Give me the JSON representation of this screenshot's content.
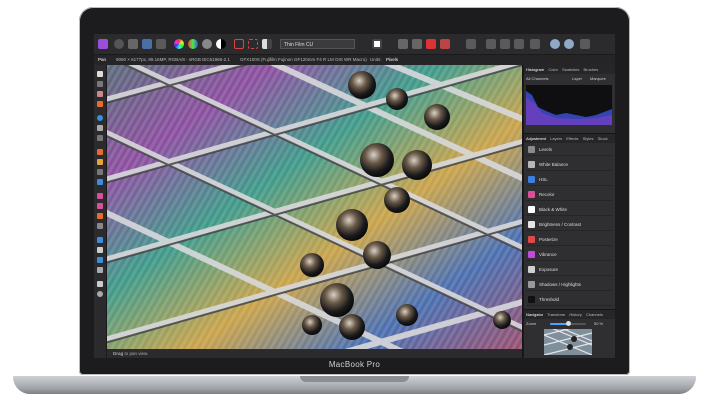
{
  "device": {
    "brand_label": "MacBook Pro"
  },
  "toolbar": {
    "persona_label": "Affinity Photo",
    "document_name": "Thin Film CU"
  },
  "context_bar": {
    "tool_name": "Pan",
    "doc_info": "9060 × 6177px, 89.16MP, RGBA/8 - sRGB IEC61966-2.1",
    "camera_info": "GFX100S (Fujifilm Fujinon GF120mm F4 R LM OIS WR Macro)",
    "units_label": "Units:",
    "units_value": "Pixels"
  },
  "histogram_panel": {
    "tabs": [
      "Histogram",
      "Color",
      "Swatches",
      "Brushes"
    ],
    "channel": "All Channels",
    "layer_label": "Layer",
    "marquee_label": "Marquee"
  },
  "adjustment_panel": {
    "tabs": [
      "Adjustment",
      "Layers",
      "Effects",
      "Styles",
      "Stock"
    ],
    "items": [
      {
        "label": "Levels",
        "color": "#8a8a8a"
      },
      {
        "label": "White Balance",
        "color": "#b7b7b7"
      },
      {
        "label": "HSL",
        "color": "#3c7de0"
      },
      {
        "label": "Recolor",
        "color": "#d94f9a"
      },
      {
        "label": "Black & White",
        "color": "#ffffff"
      },
      {
        "label": "Brightness / Contrast",
        "color": "#e5e5e5"
      },
      {
        "label": "Posterize",
        "color": "#e04848"
      },
      {
        "label": "Vibrance",
        "color": "#c24ad9"
      },
      {
        "label": "Exposure",
        "color": "#cfcfcf"
      },
      {
        "label": "Shadows / Highlights",
        "color": "#9a9a9a"
      },
      {
        "label": "Threshold",
        "color": "#111111"
      }
    ]
  },
  "navigator_panel": {
    "tabs": [
      "Navigator",
      "Transform",
      "History",
      "Channels"
    ],
    "zoom_label": "Zoom",
    "zoom_value": "50 %",
    "zoom_fraction": 0.5
  },
  "status_bar": {
    "hint_bold": "Drag",
    "hint_text": "to pan view."
  },
  "colors": {
    "accent": "#4aa3ff",
    "affinity_purple": "#9b4fd8"
  }
}
